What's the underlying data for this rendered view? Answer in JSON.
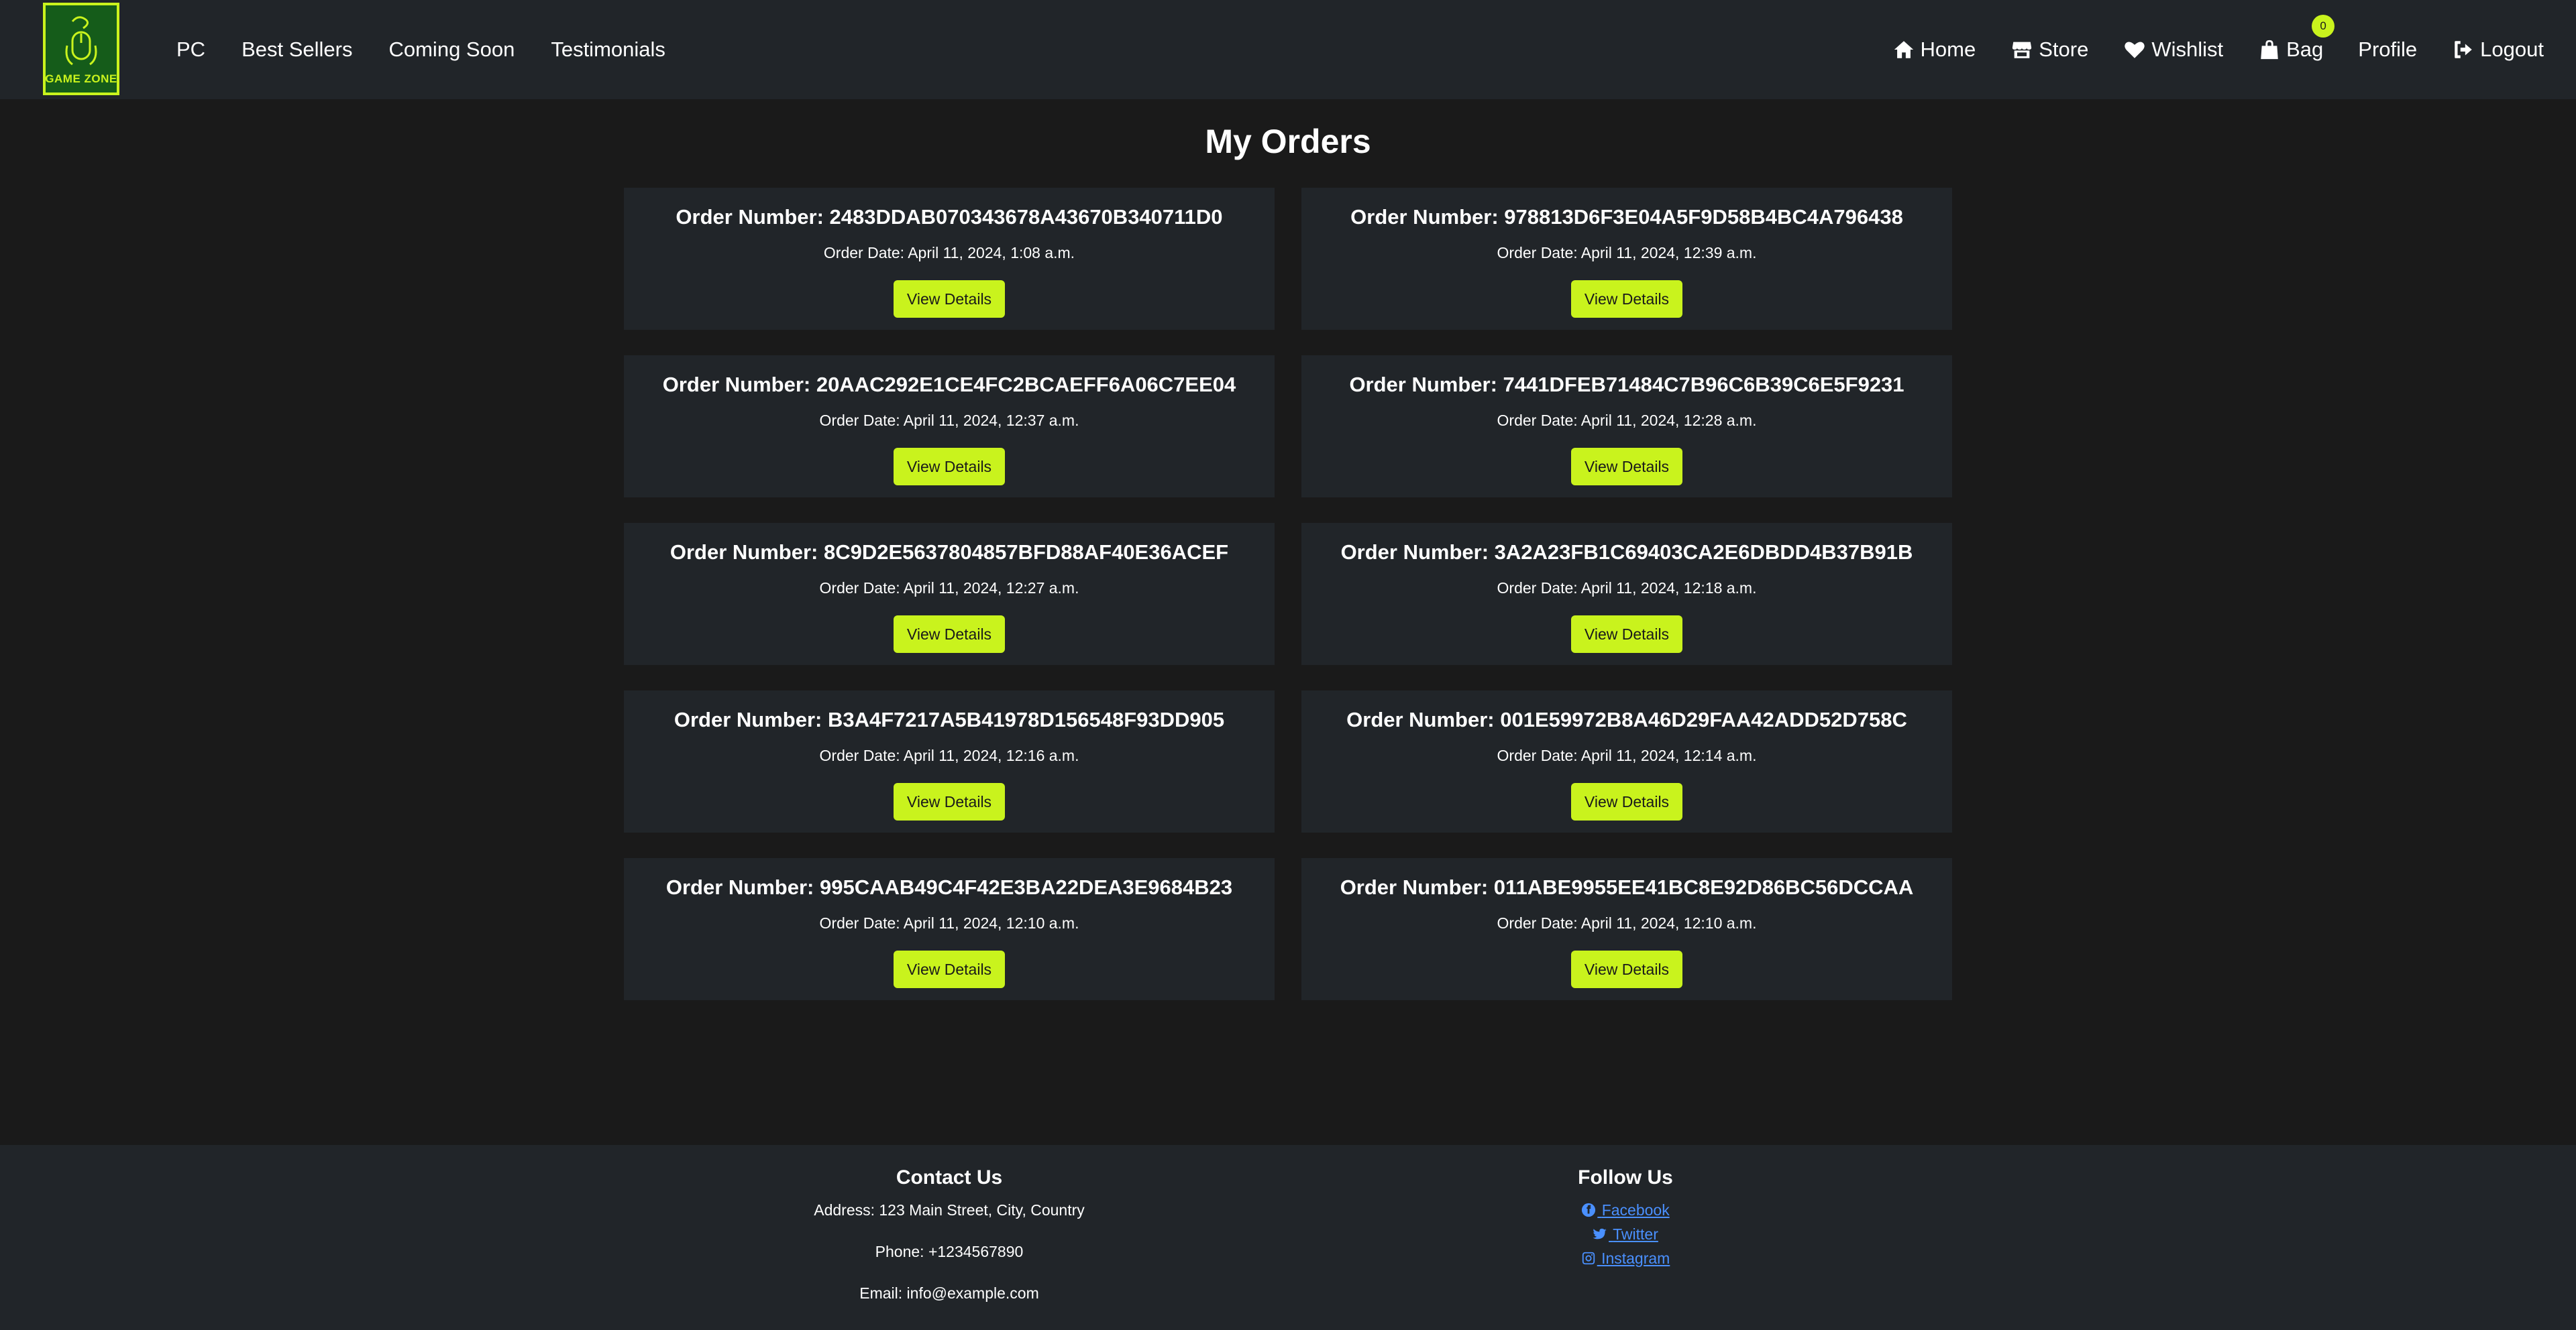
{
  "brand": {
    "logo_text": "GAME ZONE"
  },
  "nav": {
    "left": [
      "PC",
      "Best Sellers",
      "Coming Soon",
      "Testimonials"
    ],
    "home": "Home",
    "store": "Store",
    "wishlist": "Wishlist",
    "bag": "Bag",
    "bag_count": "0",
    "profile": "Profile",
    "logout": "Logout"
  },
  "page": {
    "title": "My Orders"
  },
  "labels": {
    "order_number_prefix": "Order Number:",
    "order_date_prefix": "Order Date:",
    "view_details": "View Details"
  },
  "orders": [
    {
      "number": "2483DDAB070343678A43670B340711D0",
      "date": "April 11, 2024, 1:08 a.m."
    },
    {
      "number": "978813D6F3E04A5F9D58B4BC4A796438",
      "date": "April 11, 2024, 12:39 a.m."
    },
    {
      "number": "20AAC292E1CE4FC2BCAEFF6A06C7EE04",
      "date": "April 11, 2024, 12:37 a.m."
    },
    {
      "number": "7441DFEB71484C7B96C6B39C6E5F9231",
      "date": "April 11, 2024, 12:28 a.m."
    },
    {
      "number": "8C9D2E5637804857BFD88AF40E36ACEF",
      "date": "April 11, 2024, 12:27 a.m."
    },
    {
      "number": "3A2A23FB1C69403CA2E6DBDD4B37B91B",
      "date": "April 11, 2024, 12:18 a.m."
    },
    {
      "number": "B3A4F7217A5B41978D156548F93DD905",
      "date": "April 11, 2024, 12:16 a.m."
    },
    {
      "number": "001E59972B8A46D29FAA42ADD52D758C",
      "date": "April 11, 2024, 12:14 a.m."
    },
    {
      "number": "995CAAB49C4F42E3BA22DEA3E9684B23",
      "date": "April 11, 2024, 12:10 a.m."
    },
    {
      "number": "011ABE9955EE41BC8E92D86BC56DCCAA",
      "date": "April 11, 2024, 12:10 a.m."
    }
  ],
  "footer": {
    "contact_title": "Contact Us",
    "address": "Address: 123 Main Street, City, Country",
    "phone": "Phone: +1234567890",
    "email": "Email: info@example.com",
    "follow_title": "Follow Us",
    "facebook": "Facebook",
    "twitter": "Twitter",
    "instagram": "Instagram"
  },
  "colors": {
    "accent": "#c9f31d",
    "background": "#1a1a1a",
    "panel": "#212529",
    "link": "#4a90ff"
  },
  "icons": {
    "home": "home-icon",
    "store": "store-icon",
    "wishlist": "heart-icon",
    "bag": "shopping-bag-icon",
    "logout": "logout-icon",
    "facebook": "facebook-icon",
    "twitter": "twitter-icon",
    "instagram": "instagram-icon"
  }
}
